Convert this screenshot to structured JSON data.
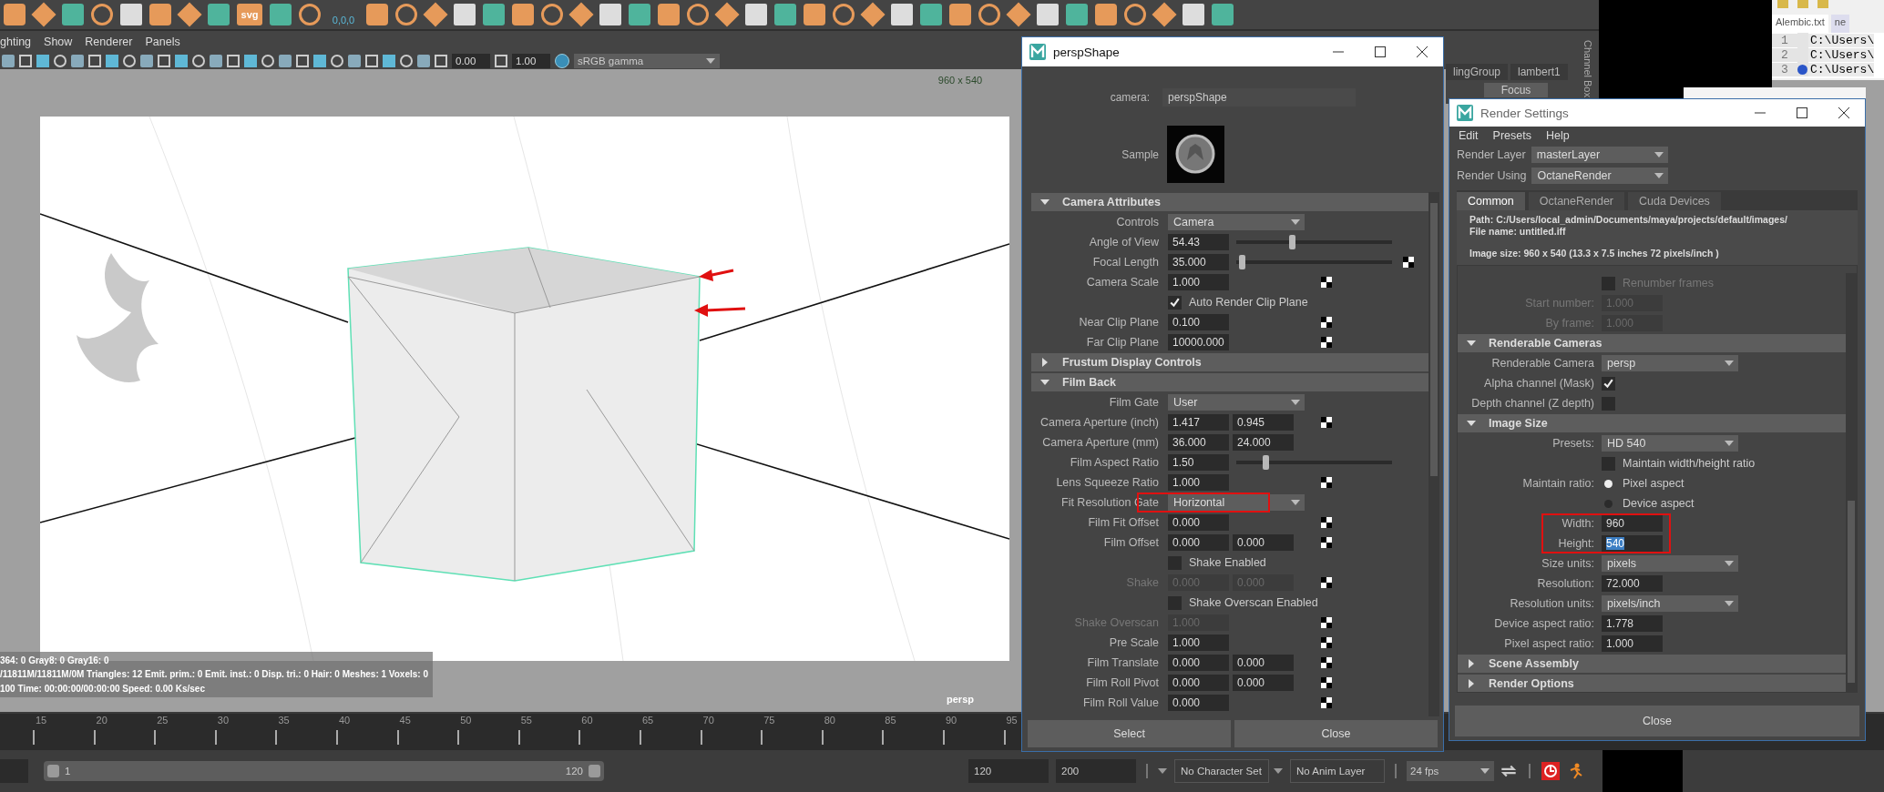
{
  "shelf": {
    "svg_label": "svg",
    "coords_label": "0,0,0"
  },
  "menu_bar": [
    "ghting",
    "Show",
    "Renderer",
    "Panels"
  ],
  "viewport_toolbar": {
    "exposure": "0.00",
    "gamma": "1.00",
    "color_space": "sRGB gamma"
  },
  "viewport": {
    "resolution_label": "960 x 540",
    "hud_lines": [
      "364: 0 Gray8: 0 Gray16: 0",
      "/11811M/11811M/0M Triangles: 12 Emit. prim.: 0 Emit. inst.: 0 Disp. tri.: 0 Hair: 0 Meshes: 1 Voxels: 0",
      "100 Time: 00:00:00/00:00:00 Speed: 0.00 Ks/sec"
    ],
    "camera_label": "persp"
  },
  "timeline": {
    "ticks": [
      "15",
      "20",
      "25",
      "30",
      "35",
      "40",
      "45",
      "50",
      "55",
      "60",
      "65",
      "70",
      "75",
      "80",
      "85",
      "90",
      "95"
    ]
  },
  "range_bar": {
    "range_start": "1",
    "range_end": "120",
    "end_time": "120",
    "max_time": "200",
    "character_set": "No Character Set",
    "anim_layer": "No Anim Layer",
    "fps": "24 fps"
  },
  "channel_box": {
    "tabs": [
      "lingGroup",
      "lambert1"
    ],
    "focus_button": "Focus",
    "side_label": "Channel Box"
  },
  "notepad": {
    "tabs": [
      {
        "label": "Alembic.txt",
        "selected": true
      },
      {
        "label": "ne",
        "selected": false
      }
    ],
    "lines": [
      {
        "number": "1",
        "text": "C:\\Users\\",
        "bookmarked": false
      },
      {
        "number": "2",
        "text": "C:\\Users\\",
        "bookmarked": false
      },
      {
        "number": "3",
        "text": "C:\\Users\\",
        "bookmarked": true
      }
    ]
  },
  "persp_window": {
    "title": "perspShape",
    "camera_label": "camera:",
    "camera_value": "perspShape",
    "sample_label": "Sample",
    "items": [
      {
        "kind": "section",
        "label": "Camera Attributes",
        "expanded": true
      },
      {
        "kind": "dropdown",
        "label": "Controls",
        "value": "Camera"
      },
      {
        "kind": "slider",
        "label": "Angle of View",
        "values": [
          "54.43"
        ],
        "level": 0.34
      },
      {
        "kind": "slider",
        "label": "Focal Length",
        "values": [
          "35.000"
        ],
        "level": 0.02,
        "map": true
      },
      {
        "kind": "field",
        "label": "Camera Scale",
        "values": [
          "1.000"
        ],
        "map": true
      },
      {
        "kind": "checkbox",
        "text": "Auto Render Clip Plane",
        "checked": true
      },
      {
        "kind": "field",
        "label": "Near Clip Plane",
        "values": [
          "0.100"
        ],
        "map": true
      },
      {
        "kind": "field",
        "label": "Far Clip Plane",
        "values": [
          "10000.000"
        ],
        "map": true
      },
      {
        "kind": "section",
        "label": "Frustum Display Controls",
        "expanded": false
      },
      {
        "kind": "section",
        "label": "Film Back",
        "expanded": true
      },
      {
        "kind": "dropdown",
        "label": "Film Gate",
        "value": "User"
      },
      {
        "kind": "field",
        "label": "Camera Aperture (inch)",
        "values": [
          "1.417",
          "0.945"
        ],
        "map": true
      },
      {
        "kind": "field",
        "label": "Camera Aperture (mm)",
        "values": [
          "36.000",
          "24.000"
        ]
      },
      {
        "kind": "slider",
        "label": "Film Aspect Ratio",
        "values": [
          "1.50"
        ],
        "level": 0.17
      },
      {
        "kind": "field",
        "label": "Lens Squeeze Ratio",
        "values": [
          "1.000"
        ],
        "map": true
      },
      {
        "kind": "dropdown",
        "label": "Fit Resolution Gate",
        "value": "Horizontal",
        "annotated": true
      },
      {
        "kind": "field",
        "label": "Film Fit Offset",
        "values": [
          "0.000"
        ],
        "map": true
      },
      {
        "kind": "field",
        "label": "Film Offset",
        "values": [
          "0.000",
          "0.000"
        ],
        "map": true
      },
      {
        "kind": "checkbox",
        "text": "Shake Enabled",
        "checked": false
      },
      {
        "kind": "field",
        "label": "Shake",
        "values": [
          "0.000",
          "0.000"
        ],
        "map": true,
        "disabled": true
      },
      {
        "kind": "checkbox",
        "text": "Shake Overscan Enabled",
        "checked": false
      },
      {
        "kind": "field",
        "label": "Shake Overscan",
        "values": [
          "1.000"
        ],
        "map": true,
        "disabled": true
      },
      {
        "kind": "field",
        "label": "Pre Scale",
        "values": [
          "1.000"
        ],
        "map": true
      },
      {
        "kind": "field",
        "label": "Film Translate",
        "values": [
          "0.000",
          "0.000"
        ],
        "map": true
      },
      {
        "kind": "field",
        "label": "Film Roll Pivot",
        "values": [
          "0.000",
          "0.000"
        ],
        "map": true
      },
      {
        "kind": "field",
        "label": "Film Roll Value",
        "values": [
          "0.000"
        ],
        "map": true
      }
    ],
    "buttons": [
      "Select",
      "Close"
    ]
  },
  "render_settings": {
    "title": "Render Settings",
    "menu": [
      "Edit",
      "Presets",
      "Help"
    ],
    "selectors": [
      {
        "label": "Render Layer",
        "value": "masterLayer"
      },
      {
        "label": "Render Using",
        "value": "OctaneRender"
      }
    ],
    "tabs": [
      {
        "label": "Common",
        "selected": true
      },
      {
        "label": "OctaneRender",
        "selected": false
      },
      {
        "label": "Cuda Devices",
        "selected": false
      }
    ],
    "info": [
      "Path: C:/Users/local_admin/Documents/maya/projects/default/images/",
      "File name:  untitled.iff",
      "Image size: 960 x 540 (13.3 x 7.5 inches 72 pixels/inch )"
    ],
    "items": [
      {
        "kind": "checkbox",
        "text": "Renumber frames",
        "checked": false,
        "disabled": true
      },
      {
        "kind": "field",
        "label": "Start number:",
        "values": [
          "1.000"
        ],
        "disabled": true
      },
      {
        "kind": "field",
        "label": "By frame:",
        "values": [
          "1.000"
        ],
        "disabled": true
      },
      {
        "kind": "section",
        "label": "Renderable Cameras",
        "expanded": true
      },
      {
        "kind": "dropdown",
        "label": "Renderable Camera",
        "value": "persp"
      },
      {
        "kind": "checkbox",
        "label": "Alpha channel (Mask)",
        "checked": true
      },
      {
        "kind": "checkbox",
        "label": "Depth channel (Z depth)",
        "checked": false
      },
      {
        "kind": "section",
        "label": "Image Size",
        "expanded": true
      },
      {
        "kind": "dropdown",
        "label": "Presets:",
        "value": "HD 540"
      },
      {
        "kind": "checkbox",
        "text": "Maintain width/height ratio",
        "checked": false
      },
      {
        "kind": "radio",
        "label": "Maintain ratio:",
        "text": "Pixel aspect",
        "selected": true
      },
      {
        "kind": "radio",
        "text": "Device aspect",
        "selected": false
      },
      {
        "kind": "field",
        "label": "Width:",
        "values": [
          "960"
        ],
        "annotated": true
      },
      {
        "kind": "field",
        "label": "Height:",
        "values": [
          "540"
        ],
        "annotated": true,
        "text_selected": true
      },
      {
        "kind": "dropdown",
        "label": "Size units:",
        "value": "pixels"
      },
      {
        "kind": "field",
        "label": "Resolution:",
        "values": [
          "72.000"
        ]
      },
      {
        "kind": "dropdown",
        "label": "Resolution units:",
        "value": "pixels/inch"
      },
      {
        "kind": "field",
        "label": "Device aspect ratio:",
        "values": [
          "1.778"
        ]
      },
      {
        "kind": "field",
        "label": "Pixel aspect ratio:",
        "values": [
          "1.000"
        ]
      },
      {
        "kind": "section",
        "label": "Scene Assembly",
        "expanded": false
      },
      {
        "kind": "section",
        "label": "Render Options",
        "expanded": false
      }
    ],
    "buttons": [
      "Close"
    ]
  }
}
